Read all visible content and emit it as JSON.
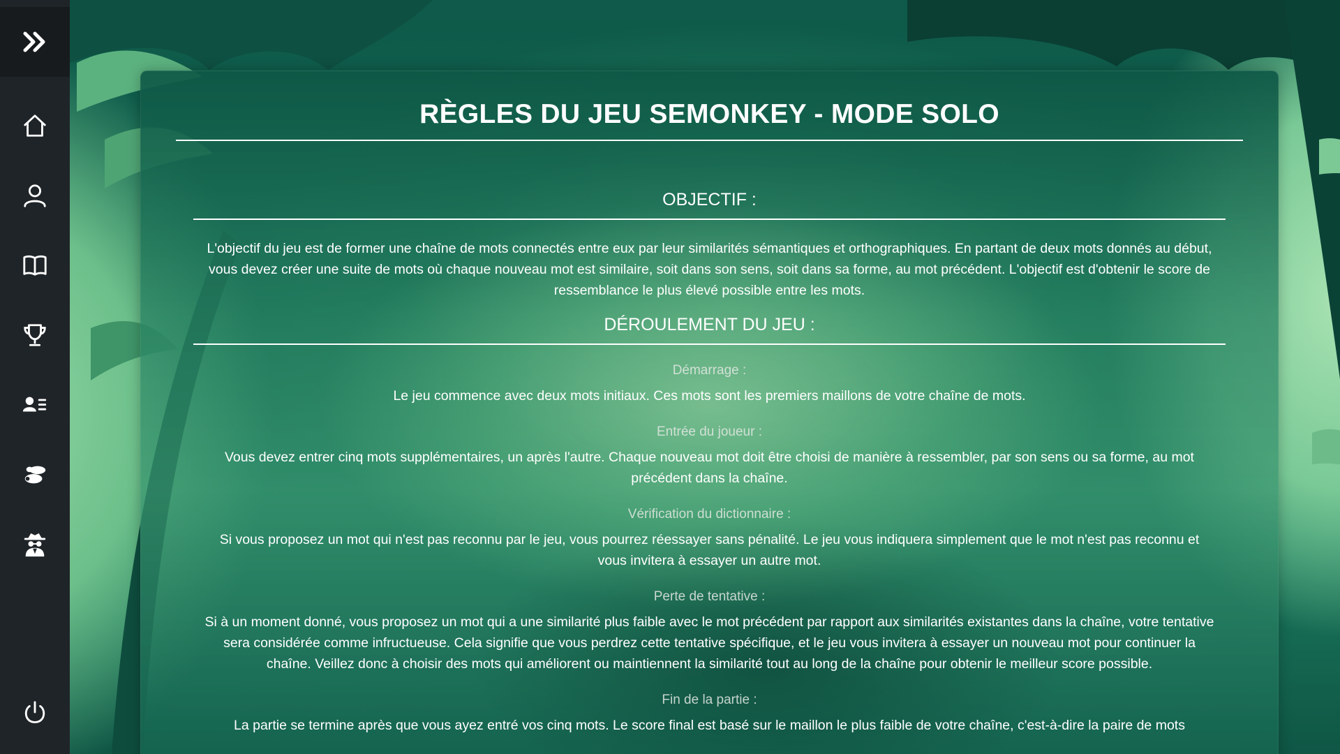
{
  "sidebar": {
    "items": [
      {
        "icon": "expand-icon"
      },
      {
        "icon": "home-icon"
      },
      {
        "icon": "user-icon"
      },
      {
        "icon": "book-icon"
      },
      {
        "icon": "trophy-icon"
      },
      {
        "icon": "contacts-list-icon"
      },
      {
        "icon": "monkey-icon"
      },
      {
        "icon": "detective-icon"
      },
      {
        "icon": "power-icon"
      }
    ],
    "icon_color": "#ffffff",
    "background": "#1f2428"
  },
  "rules": {
    "title": "RÈGLES DU JEU SEMONKEY - MODE SOLO",
    "objective": {
      "heading": "OBJECTIF :",
      "text": "L'objectif du jeu est de former une chaîne de mots connectés entre eux par leur similarités sémantiques et orthographiques. En partant de deux mots donnés au début, vous devez créer une suite de mots où chaque nouveau mot est similaire, soit dans son sens, soit dans sa forme, au mot précédent. L'objectif est d'obtenir le score de ressemblance le plus élevé possible entre les mots."
    },
    "gameplay": {
      "heading": "DÉROULEMENT DU JEU :",
      "steps": [
        {
          "title": "Démarrage :",
          "text": "Le jeu commence avec deux mots initiaux. Ces mots sont les premiers maillons de votre chaîne de mots."
        },
        {
          "title": "Entrée du joueur :",
          "text": "Vous devez entrer cinq mots supplémentaires, un après l'autre. Chaque nouveau mot doit être choisi de manière à ressembler, par son sens ou sa forme, au mot précédent dans la chaîne."
        },
        {
          "title": "Vérification du dictionnaire :",
          "text": "Si vous proposez un mot qui n'est pas reconnu par le jeu, vous pourrez réessayer sans pénalité. Le jeu vous indiquera simplement que le mot n'est pas reconnu et vous invitera à essayer un autre mot."
        },
        {
          "title": "Perte de tentative :",
          "text": "Si à un moment donné, vous proposez un mot qui a une similarité plus faible avec le mot précédent par rapport aux similarités existantes dans la chaîne, votre tentative sera considérée comme infructueuse. Cela signifie que vous perdrez cette tentative spécifique, et le jeu vous invitera à essayer un nouveau mot pour continuer la chaîne. Veillez donc à choisir des mots qui améliorent ou maintiennent la similarité tout au long de la chaîne pour obtenir le meilleur score possible."
        },
        {
          "title": "Fin de la partie :",
          "text": "La partie se termine après que vous ayez entré vos cinq mots. Le score final est basé sur le maillon le plus faible de votre chaîne, c'est-à-dire la paire de mots"
        }
      ]
    }
  }
}
